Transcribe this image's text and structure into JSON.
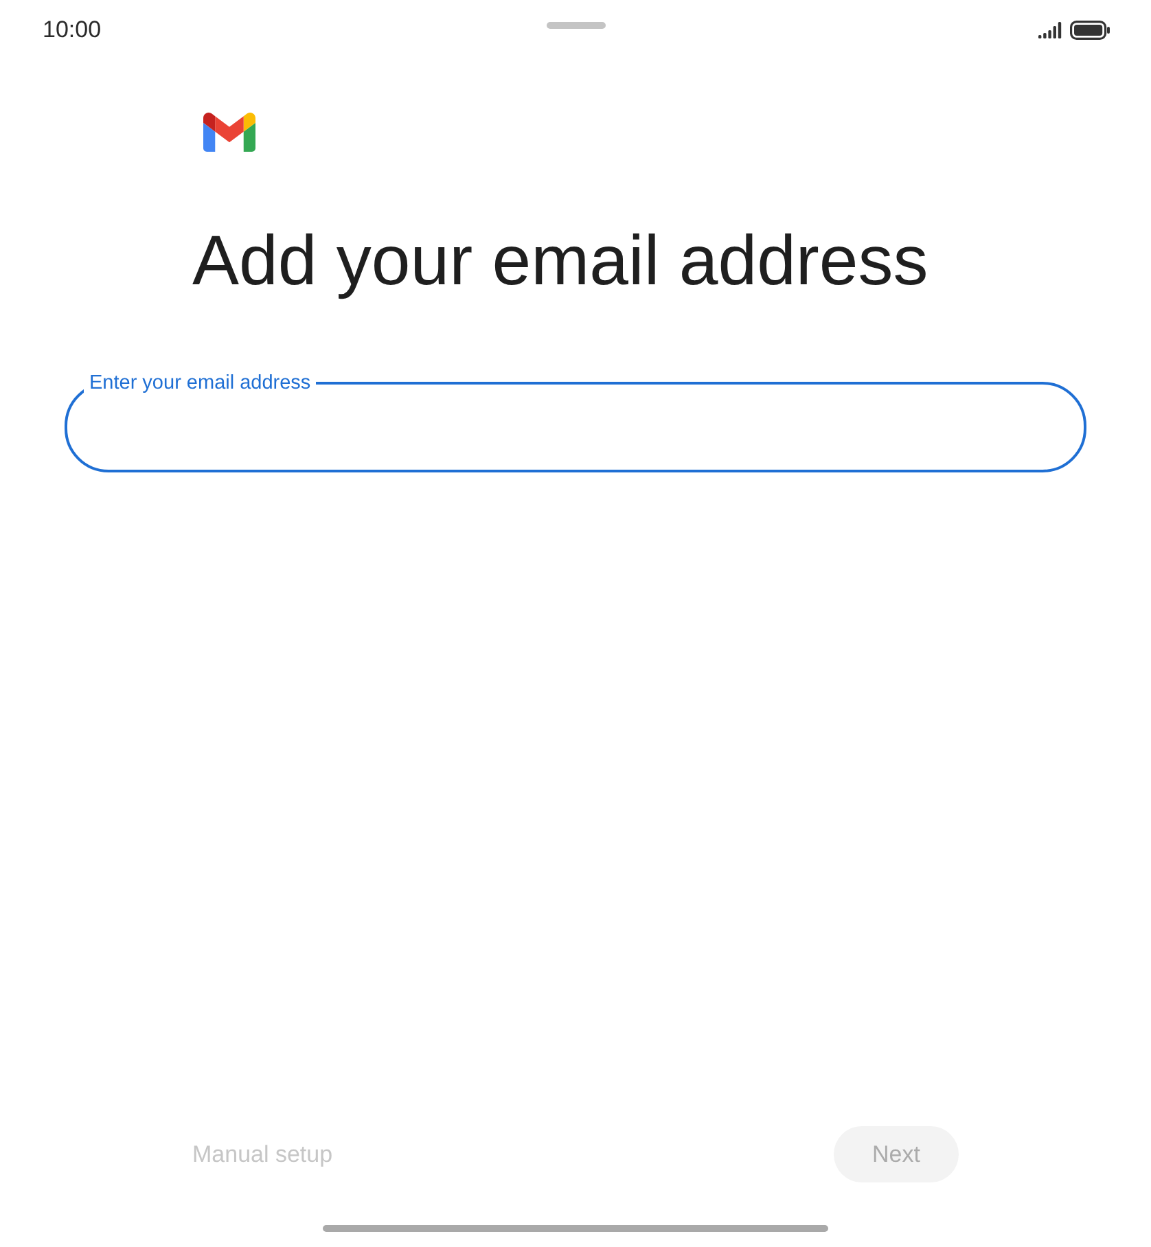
{
  "status_bar": {
    "time": "10:00"
  },
  "title": "Add your email address",
  "email_field": {
    "label": "Enter your email address",
    "focused": true
  },
  "buttons": [
    {
      "label": "Manual setup",
      "kind": "text",
      "disabled": true
    },
    {
      "label": "Next",
      "kind": "filled",
      "disabled": true
    }
  ]
}
